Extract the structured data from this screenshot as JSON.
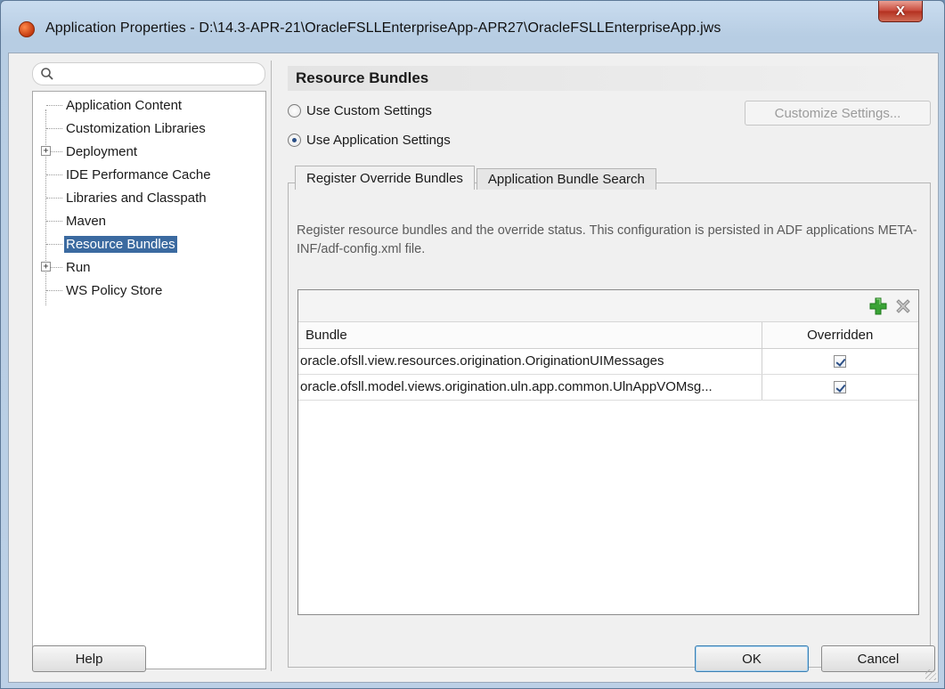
{
  "window": {
    "title": "Application Properties - D:\\14.3-APR-21\\OracleFSLLEnterpriseApp-APR27\\OracleFSLLEnterpriseApp.jws",
    "close_label": "X"
  },
  "search": {
    "placeholder": "",
    "value": ""
  },
  "tree": {
    "items": [
      {
        "label": "Application Content",
        "expandable": false,
        "selected": false
      },
      {
        "label": "Customization Libraries",
        "expandable": false,
        "selected": false
      },
      {
        "label": "Deployment",
        "expandable": true,
        "selected": false
      },
      {
        "label": "IDE Performance Cache",
        "expandable": false,
        "selected": false
      },
      {
        "label": "Libraries and Classpath",
        "expandable": false,
        "selected": false
      },
      {
        "label": "Maven",
        "expandable": false,
        "selected": false
      },
      {
        "label": "Resource Bundles",
        "expandable": false,
        "selected": true
      },
      {
        "label": "Run",
        "expandable": true,
        "selected": false
      },
      {
        "label": "WS Policy Store",
        "expandable": false,
        "selected": false
      }
    ],
    "expander_symbol": "+"
  },
  "page": {
    "title": "Resource Bundles",
    "radio_custom": {
      "label": "Use Custom Settings",
      "checked": false
    },
    "radio_app": {
      "label": "Use Application Settings",
      "checked": true
    },
    "customize_button": "Customize Settings..."
  },
  "tabs": [
    {
      "label": "Register Override Bundles",
      "active": true
    },
    {
      "label": "Application Bundle Search",
      "active": false
    }
  ],
  "description": "Register resource bundles and the override status. This configuration is persisted in ADF applications META-INF/adf-config.xml file.",
  "table": {
    "columns": [
      "Bundle",
      "Overridden"
    ],
    "rows": [
      {
        "bundle": "oracle.ofsll.view.resources.origination.OriginationUIMessages",
        "overridden": true
      },
      {
        "bundle": "oracle.ofsll.model.views.origination.uln.app.common.UlnAppVOMsg...",
        "overridden": true
      }
    ],
    "icons": [
      "add-icon",
      "remove-icon"
    ]
  },
  "buttons": {
    "help": "Help",
    "ok": "OK",
    "cancel": "Cancel"
  },
  "colors": {
    "selection": "#3b6aa0",
    "add_icon": "#3aa336",
    "ok_border": "#3c7fb1"
  }
}
